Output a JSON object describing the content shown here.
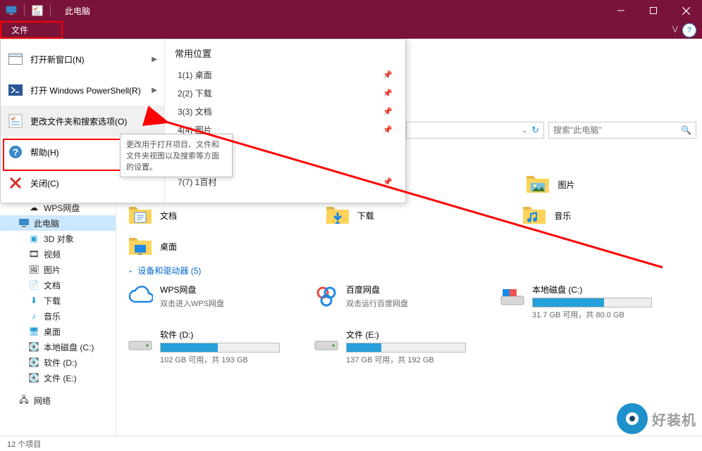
{
  "title": "此电脑",
  "file_tab": "文件",
  "help_icon": "?",
  "menu": {
    "open_new": "打开新窗口(N)",
    "powershell": "打开 Windows PowerShell(R)",
    "options": "更改文件夹和搜索选项(O)",
    "help": "帮助(H)",
    "close": "关闭(C)"
  },
  "tooltip": "更改用于打开项目、文件和文件夹视图以及搜索等方面的设置。",
  "recent": {
    "title": "常用位置",
    "items": [
      {
        "label": "1(1) 桌面"
      },
      {
        "label": "2(2) 下载"
      },
      {
        "label": "3(3) 文档"
      },
      {
        "label": "4(4) 图片"
      },
      {
        "label": "7(7) 1百村"
      }
    ]
  },
  "search_placeholder": "搜索\"此电脑\"",
  "sidebar": {
    "wps": "WPS网盘",
    "pc": "此电脑",
    "obj3d": "3D 对象",
    "video": "视频",
    "pics": "图片",
    "docs": "文档",
    "dl": "下载",
    "music": "音乐",
    "desk": "桌面",
    "cdrive": "本地磁盘 (C:)",
    "ddrive": "软件 (D:)",
    "edrive": "文件 (E:)",
    "net": "网络"
  },
  "folders": {
    "pics": "图片",
    "docs": "文档",
    "dl": "下载",
    "music": "音乐",
    "desk": "桌面"
  },
  "devices_head": "设备和驱动器 (5)",
  "drives": {
    "wps": {
      "name": "WPS网盘",
      "sub": "双击进入WPS网盘"
    },
    "baidu": {
      "name": "百度网盘",
      "sub": "双击运行百度网盘"
    },
    "c": {
      "name": "本地磁盘 (C:)",
      "sub": "31.7 GB 可用，共 80.0 GB",
      "pct": 60
    },
    "d": {
      "name": "软件 (D:)",
      "sub": "102 GB 可用，共 193 GB",
      "pct": 48
    },
    "e": {
      "name": "文件 (E:)",
      "sub": "137 GB 可用，共 192 GB",
      "pct": 29
    }
  },
  "status": "12 个项目",
  "watermark": "好装机"
}
